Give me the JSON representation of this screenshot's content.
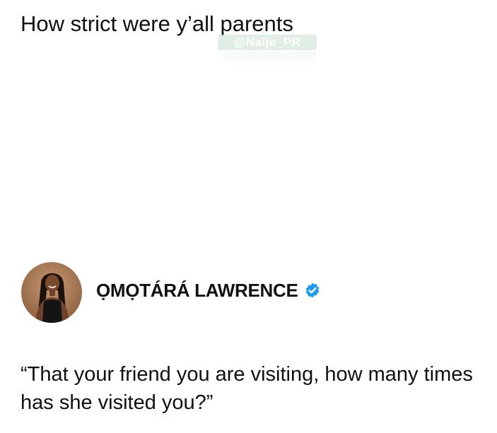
{
  "post": {
    "headline": "How strict were y’all parents",
    "watermark": "@Naija_PR"
  },
  "tweet": {
    "author_name": "ỌMỌTÁRÁ LAWRENCE",
    "verified": true,
    "avatar_icon": "profile-photo",
    "verified_icon": "verified-badge-icon",
    "quote": "“That your friend you are visiting, how many times has she visited you?”"
  },
  "colors": {
    "background": "#ffffff",
    "text": "#111111",
    "verified_blue": "#1d9bf0"
  }
}
